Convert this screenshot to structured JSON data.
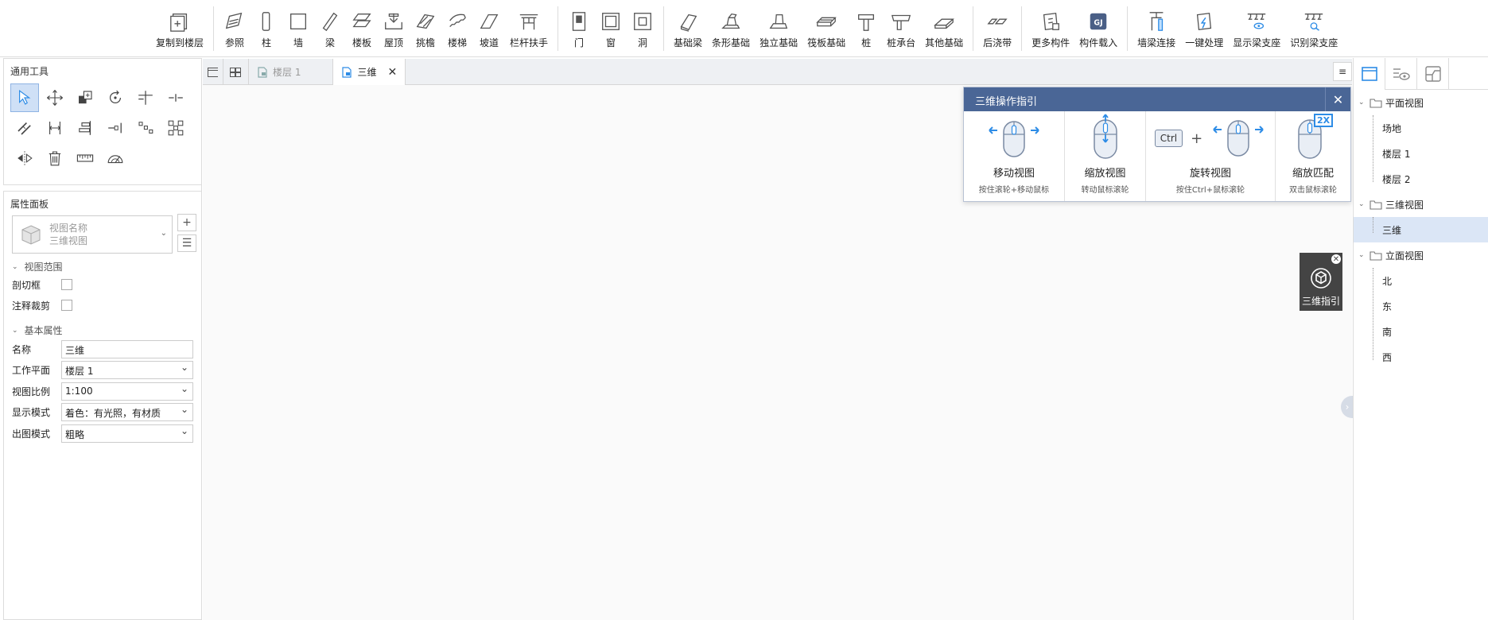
{
  "ribbon": {
    "groups": [
      [
        {
          "label": "复制到楼层",
          "icon": "copy-to-floor-icon"
        }
      ],
      [
        {
          "label": "参照",
          "icon": "reference-icon"
        },
        {
          "label": "柱",
          "icon": "column-icon"
        },
        {
          "label": "墙",
          "icon": "wall-icon"
        },
        {
          "label": "梁",
          "icon": "beam-icon"
        },
        {
          "label": "楼板",
          "icon": "slab-icon"
        },
        {
          "label": "屋顶",
          "icon": "roof-icon"
        },
        {
          "label": "挑檐",
          "icon": "eave-icon"
        },
        {
          "label": "楼梯",
          "icon": "stairs-icon"
        },
        {
          "label": "坡道",
          "icon": "ramp-icon"
        },
        {
          "label": "栏杆扶手",
          "icon": "railing-icon"
        }
      ],
      [
        {
          "label": "门",
          "icon": "door-icon"
        },
        {
          "label": "窗",
          "icon": "window-icon"
        },
        {
          "label": "洞",
          "icon": "opening-icon"
        }
      ],
      [
        {
          "label": "基础梁",
          "icon": "foundation-beam-icon"
        },
        {
          "label": "条形基础",
          "icon": "strip-foundation-icon"
        },
        {
          "label": "独立基础",
          "icon": "isolated-foundation-icon"
        },
        {
          "label": "筏板基础",
          "icon": "raft-foundation-icon"
        },
        {
          "label": "桩",
          "icon": "pile-icon"
        },
        {
          "label": "桩承台",
          "icon": "pile-cap-icon"
        },
        {
          "label": "其他基础",
          "icon": "other-foundation-icon"
        }
      ],
      [
        {
          "label": "后浇带",
          "icon": "post-cast-strip-icon"
        }
      ],
      [
        {
          "label": "更多构件",
          "icon": "more-components-icon"
        },
        {
          "label": "构件载入",
          "icon": "load-component-icon"
        }
      ],
      [
        {
          "label": "墙梁连接",
          "icon": "wall-beam-connect-icon"
        },
        {
          "label": "一键处理",
          "icon": "one-click-icon"
        },
        {
          "label": "显示梁支座",
          "icon": "show-support-icon"
        },
        {
          "label": "识别梁支座",
          "icon": "identify-support-icon"
        }
      ]
    ]
  },
  "general_tools": {
    "title": "通用工具",
    "tools": [
      "select-arrow-icon",
      "move-icon",
      "copy-icon",
      "rotate-icon",
      "trim-icon",
      "split-icon",
      "offset-icon",
      "dimension-icon",
      "align-icon",
      "extend-icon",
      "array-icon",
      "group-icon",
      "mirror-icon",
      "delete-icon",
      "measure-icon",
      "angle-measure-icon"
    ]
  },
  "properties": {
    "title": "属性面板",
    "view_name_label": "视图名称",
    "view_name_value": "三维视图",
    "section_range": "视图范围",
    "cut_box": "剖切框",
    "annotation_crop": "注释裁剪",
    "section_basic": "基本属性",
    "fields": [
      {
        "key": "名称",
        "value": "三维",
        "dropdown": false
      },
      {
        "key": "工作平面",
        "value": "楼层 1",
        "dropdown": true
      },
      {
        "key": "视图比例",
        "value": "1:100",
        "dropdown": true
      },
      {
        "key": "显示模式",
        "value": "着色：有光照，有材质",
        "dropdown": true
      },
      {
        "key": "出图模式",
        "value": "粗略",
        "dropdown": true
      }
    ]
  },
  "tabs": {
    "items": [
      {
        "label": "楼层 1",
        "active": false
      },
      {
        "label": "三维",
        "active": true
      }
    ],
    "menu_glyph": "≡"
  },
  "guide": {
    "title": "三维操作指引",
    "items": [
      {
        "title": "移动视图",
        "sub": "按住滚轮+移动鼠标"
      },
      {
        "title": "缩放视图",
        "sub": "转动鼠标滚轮"
      },
      {
        "title": "旋转视图",
        "sub": "按住Ctrl+鼠标滚轮",
        "key": "Ctrl",
        "plus": "+"
      },
      {
        "title": "缩放匹配",
        "sub": "双击鼠标滚轮",
        "badge": "2X"
      }
    ]
  },
  "floating_guide": {
    "label": "三维指引"
  },
  "view_tree": {
    "groups": [
      {
        "label": "平面视图",
        "items": [
          "场地",
          "楼层 1",
          "楼层 2"
        ]
      },
      {
        "label": "三维视图",
        "items": [
          "三维"
        ],
        "selected": "三维"
      },
      {
        "label": "立面视图",
        "items": [
          "北",
          "东",
          "南",
          "西"
        ]
      }
    ]
  },
  "colors": {
    "accent": "#4a6696",
    "icon_blue": "#2d8ce6",
    "selection": "#dbe6f6"
  }
}
